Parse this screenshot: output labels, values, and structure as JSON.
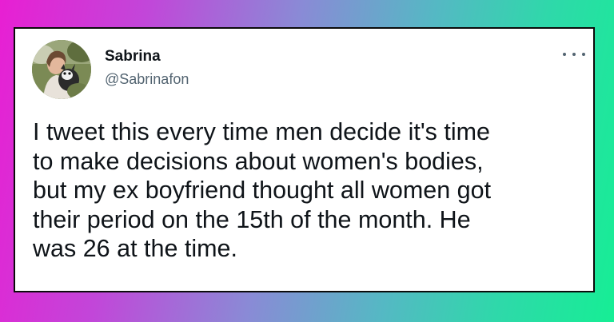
{
  "tweet": {
    "author": {
      "display_name": "Sabrina",
      "handle": "@Sabrinafon"
    },
    "text": "I tweet this every time men decide it's time\nto make decisions about women's bodies,\nbut my ex boyfriend thought all women got\ntheir period on the 15th of the month. He\nwas 26 at the time."
  },
  "icons": {
    "avatar": "profile-photo",
    "more": "more-options-icon"
  },
  "colors": {
    "gradient_left": "#e81fd3",
    "gradient_right": "#16ee95",
    "card_background": "#ffffff",
    "card_border": "#0b0b0b",
    "text_primary": "#0f1419",
    "text_secondary": "#536471"
  }
}
